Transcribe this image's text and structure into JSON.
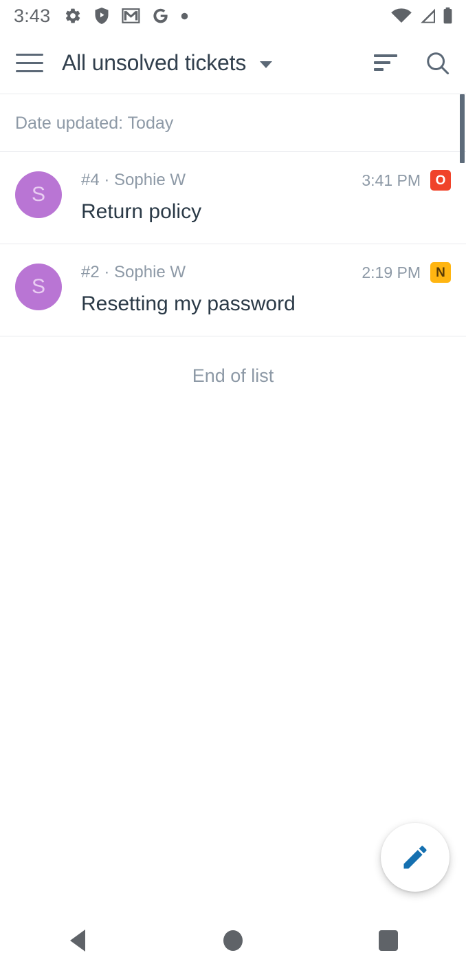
{
  "status_bar": {
    "time": "3:43",
    "left_icons": [
      "gear-icon",
      "play-protect-shield-icon",
      "gmail-icon",
      "google-g-icon",
      "more-dot-icon"
    ],
    "right_icons": [
      "wifi-icon",
      "cellular-signal-icon",
      "battery-icon"
    ]
  },
  "app_bar": {
    "menu_icon": "hamburger-menu-icon",
    "title": "All unsolved tickets",
    "dropdown_icon": "chevron-down-icon",
    "sort_icon": "sort-icon",
    "search_icon": "search-icon"
  },
  "list": {
    "section_header": "Date updated: Today",
    "end_of_list": "End of list",
    "tickets": [
      {
        "avatar_initial": "S",
        "avatar_color": "#b975d4",
        "reference": "#4 · Sophie W",
        "subject": "Return policy",
        "time": "3:41 PM",
        "status_badge": "O",
        "status_color": "#f0432a"
      },
      {
        "avatar_initial": "S",
        "avatar_color": "#b975d4",
        "reference": "#2 · Sophie W",
        "subject": "Resetting my password",
        "time": "2:19 PM",
        "status_badge": "N",
        "status_color": "#ffb511"
      }
    ]
  },
  "fab": {
    "icon": "compose-pencil-icon",
    "color": "#1570b0"
  },
  "nav_bar": {
    "back": "back-icon",
    "home": "home-icon",
    "recents": "recents-icon"
  }
}
